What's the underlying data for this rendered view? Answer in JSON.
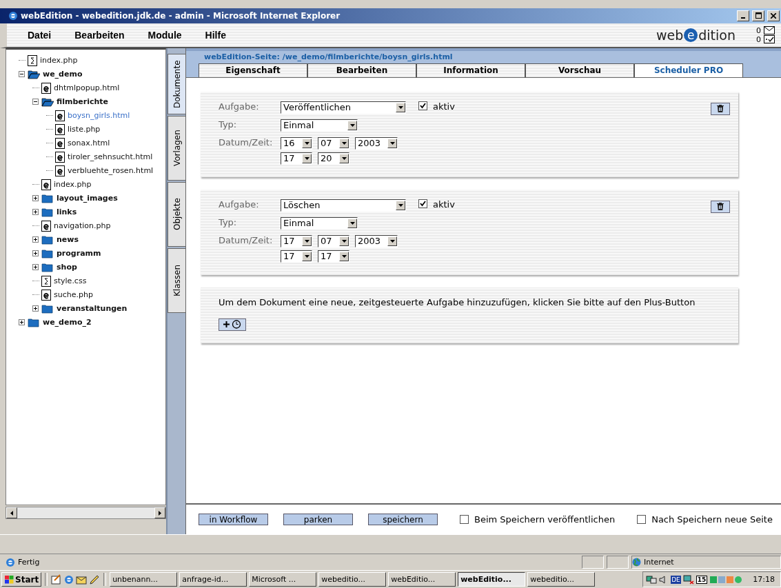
{
  "window": {
    "title": "webEdition - webedition.jdk.de - admin - Microsoft Internet Explorer"
  },
  "menu": [
    "Datei",
    "Bearbeiten",
    "Module",
    "Hilfe"
  ],
  "logo": {
    "prefix": "web",
    "mark": "e",
    "suffix": "dition"
  },
  "counters": [
    "0",
    "0"
  ],
  "tree": [
    {
      "label": "index.php",
      "kind": "script",
      "selected": false
    },
    {
      "label": "we_demo",
      "kind": "folder",
      "expanded": true,
      "selected": false,
      "children": [
        {
          "label": "dhtmlpopup.html",
          "kind": "page",
          "selected": false
        },
        {
          "label": "filmberichte",
          "kind": "folder",
          "expanded": true,
          "selected": false,
          "children": [
            {
              "label": "boysn_girls.html",
              "kind": "page",
              "selected": true
            },
            {
              "label": "liste.php",
              "kind": "page",
              "selected": false
            },
            {
              "label": "sonax.html",
              "kind": "page",
              "selected": false
            },
            {
              "label": "tiroler_sehnsucht.html",
              "kind": "page",
              "selected": false
            },
            {
              "label": "verbluehte_rosen.html",
              "kind": "page",
              "selected": false
            }
          ]
        },
        {
          "label": "index.php",
          "kind": "page",
          "selected": false
        },
        {
          "label": "layout_images",
          "kind": "folder",
          "expanded": false,
          "selected": false
        },
        {
          "label": "links",
          "kind": "folder",
          "expanded": false,
          "selected": false
        },
        {
          "label": "navigation.php",
          "kind": "page",
          "selected": false
        },
        {
          "label": "news",
          "kind": "folder",
          "expanded": false,
          "selected": false
        },
        {
          "label": "programm",
          "kind": "folder",
          "expanded": false,
          "selected": false
        },
        {
          "label": "shop",
          "kind": "folder",
          "expanded": false,
          "selected": false
        },
        {
          "label": "style.css",
          "kind": "script",
          "selected": false
        },
        {
          "label": "suche.php",
          "kind": "page",
          "selected": false
        },
        {
          "label": "veranstaltungen",
          "kind": "folder",
          "expanded": false,
          "selected": false
        }
      ]
    },
    {
      "label": "we_demo_2",
      "kind": "folder",
      "expanded": false,
      "selected": false
    }
  ],
  "side_tabs": [
    {
      "label": "Dokumente",
      "selected": true
    },
    {
      "label": "Vorlagen",
      "selected": false
    },
    {
      "label": "Objekte",
      "selected": false
    },
    {
      "label": "Klassen",
      "selected": false
    }
  ],
  "breadcrumb": "webEdition-Seite: /we_demo/filmberichte/boysn_girls.html",
  "tabs": [
    {
      "label": "Eigenschaft",
      "selected": false
    },
    {
      "label": "Bearbeiten",
      "selected": false
    },
    {
      "label": "Information",
      "selected": false
    },
    {
      "label": "Vorschau",
      "selected": false
    },
    {
      "label": "Scheduler PRO",
      "selected": true
    }
  ],
  "tasks": [
    {
      "task_label": "Aufgabe:",
      "task": "Veröffentlichen",
      "active_label": "aktiv",
      "active": true,
      "type_label": "Typ:",
      "type": "Einmal",
      "datetime_label": "Datum/Zeit:",
      "date": [
        "16",
        "07",
        "2003"
      ],
      "time": [
        "17",
        "20"
      ]
    },
    {
      "task_label": "Aufgabe:",
      "task": "Löschen",
      "active_label": "aktiv",
      "active": true,
      "type_label": "Typ:",
      "type": "Einmal",
      "datetime_label": "Datum/Zeit:",
      "date": [
        "17",
        "07",
        "2003"
      ],
      "time": [
        "17",
        "17"
      ]
    }
  ],
  "hint": "Um dem Dokument eine neue, zeitgesteuerte Aufgabe hinzuzufügen, klicken Sie bitte auf den Plus-Button",
  "footer_buttons": [
    "in Workflow",
    "parken",
    "speichern"
  ],
  "footer_options": [
    {
      "label": "Beim Speichern veröffentlichen",
      "checked": false
    },
    {
      "label": "Nach Speichern neue Seite",
      "checked": false
    }
  ],
  "status_bar": {
    "text": "Fertig",
    "zone": "Internet"
  },
  "taskbar": {
    "start": "Start",
    "tasks": [
      {
        "label": "unbenann...",
        "selected": false
      },
      {
        "label": "anfrage-id...",
        "selected": false
      },
      {
        "label": "Microsoft ...",
        "selected": false
      },
      {
        "label": "webeditio...",
        "selected": false
      },
      {
        "label": "webEditio...",
        "selected": false
      },
      {
        "label": "webEditio...",
        "selected": true
      },
      {
        "label": "webeditio...",
        "selected": false
      }
    ],
    "language": "DE",
    "day": "15",
    "clock": "17:18"
  }
}
